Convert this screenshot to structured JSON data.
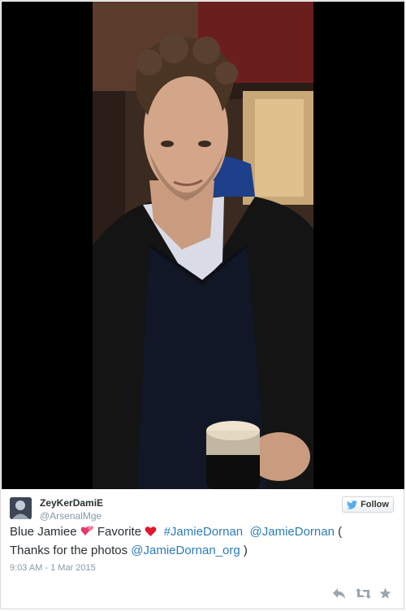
{
  "tweet": {
    "author_name": "ZeyKerDamiE",
    "author_handle": "@ArsenalMge",
    "follow_label": "Follow",
    "text_parts": {
      "p1": "Blue Jamiee ",
      "p2": " Favorite ",
      "hashtag": "#JamieDornan",
      "mention1": "@JamieDornan",
      "p3": " (",
      "p4": "Thanks for the photos ",
      "mention2": "@JamieDornan_org",
      "p5": " )"
    },
    "timestamp": "9:03 AM - 1 Mar 2015"
  },
  "icons": {
    "reply": "reply-icon",
    "retweet": "retweet-icon",
    "favorite": "favorite-icon",
    "bird": "twitter-bird-icon",
    "emoji1": "two-hearts-emoji",
    "emoji2": "red-heart-emoji"
  },
  "colors": {
    "link": "#2b7bb9",
    "text": "#292f33",
    "muted": "#8899a6",
    "bird": "#55acee"
  }
}
